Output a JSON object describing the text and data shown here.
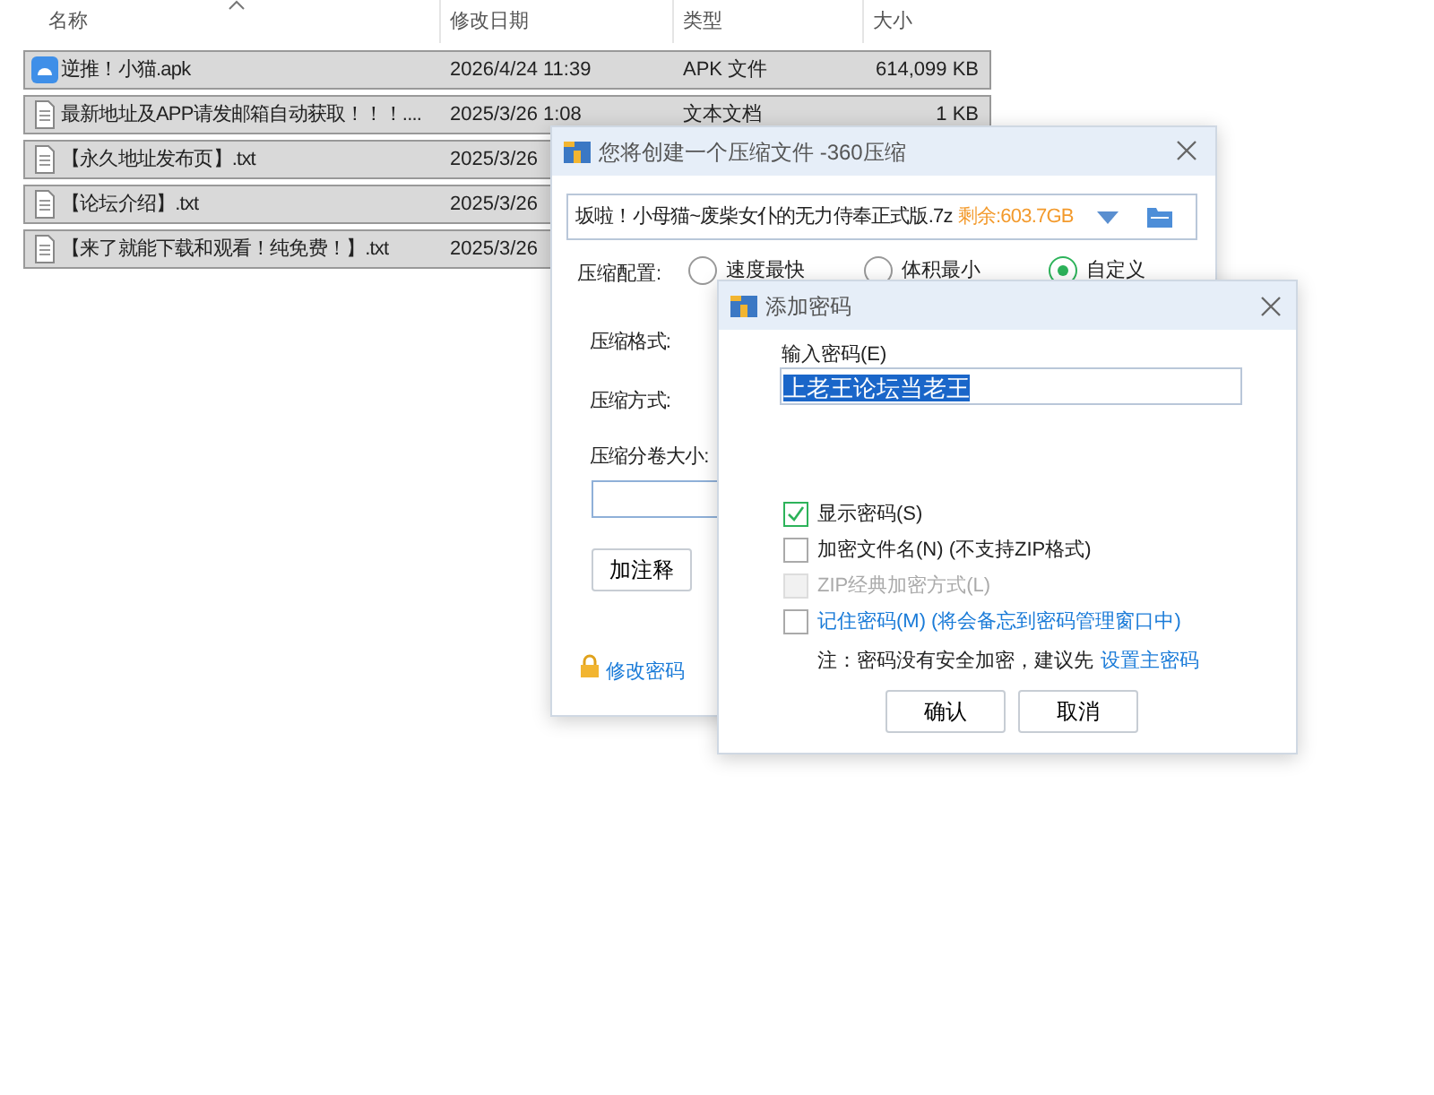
{
  "file_list": {
    "columns": [
      "名称",
      "修改日期",
      "类型",
      "大小"
    ],
    "rows": [
      {
        "kind": "apk",
        "name": "逆推！小猫.apk",
        "date": "2026/4/24 11:39",
        "type": "APK 文件",
        "size": "614,099 KB",
        "selected": true
      },
      {
        "kind": "text",
        "name": "最新地址及APP请发邮箱自动获取！！！....",
        "date": "2025/3/26 1:08",
        "type": "文本文档",
        "size": "1 KB",
        "selected": true
      },
      {
        "kind": "text",
        "name": "【永久地址发布页】.txt",
        "date": "2025/3/26",
        "selected": true
      },
      {
        "kind": "text",
        "name": "【论坛介绍】.txt",
        "date": "2025/3/26",
        "selected": true
      },
      {
        "kind": "text",
        "name": "【来了就能下载和观看！纯免费！】.txt",
        "date": "2025/3/26",
        "selected": true
      }
    ]
  },
  "compress_dialog": {
    "title": "您将创建一个压缩文件 -360压缩",
    "archive_name": "坂啦！小母猫~废柴女仆的无力侍奉正式版.7z",
    "free_space": "剩余:603.7GB",
    "config_label": "压缩配置:",
    "options": [
      {
        "label": "速度最快",
        "selected": false
      },
      {
        "label": "体积最小",
        "selected": false
      },
      {
        "label": "自定义",
        "selected": true
      }
    ],
    "format_label": "压缩格式:",
    "method_label": "压缩方式:",
    "split_label": "压缩分卷大小:",
    "comment_button": "加注释",
    "change_password": "修改密码"
  },
  "password_dialog": {
    "title": "添加密码",
    "password_label": "输入密码(E)",
    "password": "上老王论坛当老王",
    "password_selected": true,
    "options": [
      {
        "kind": "plain",
        "label": "显示密码(S)",
        "checked": true,
        "disabled": false
      },
      {
        "kind": "plain",
        "label": "加密文件名(N) (不支持ZIP格式)",
        "checked": false,
        "disabled": false
      },
      {
        "kind": "plain",
        "label": "ZIP经典加密方式(L)",
        "checked": false,
        "disabled": true
      },
      {
        "kind": "link",
        "label": "记住密码(M) (将会备忘到密码管理窗口中)",
        "checked": false,
        "disabled": false
      }
    ],
    "note": "注：密码没有安全加密，建议先",
    "note_link": "设置主密码",
    "buttons": [
      "确认",
      "取消"
    ]
  }
}
